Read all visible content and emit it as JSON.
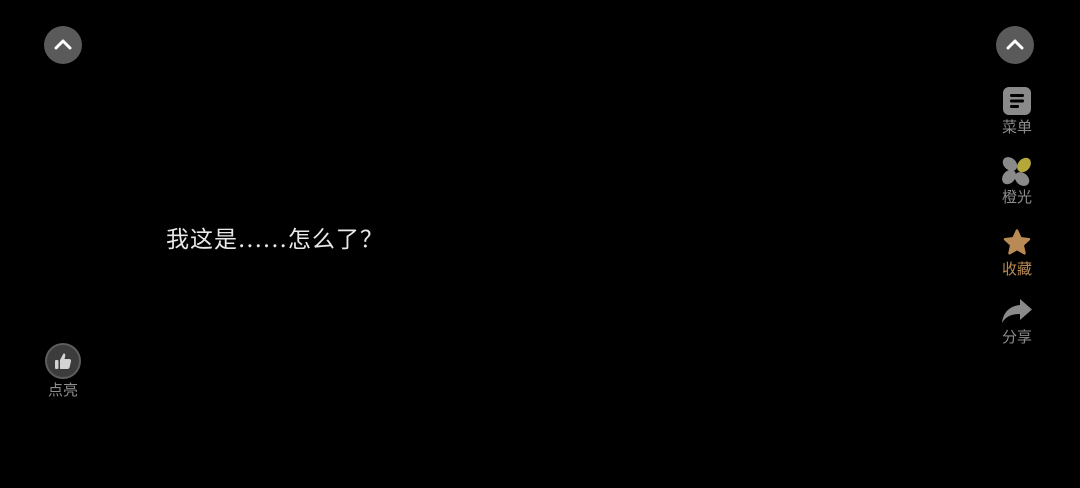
{
  "story": {
    "dialogue_text": "我这是......怎么了？"
  },
  "controls": {
    "collapse_left_icon": "chevron-up-icon",
    "collapse_right_icon": "chevron-up-icon"
  },
  "side_menu": {
    "items": [
      {
        "key": "menu",
        "label": "菜单",
        "icon": "list-icon"
      },
      {
        "key": "orange-light",
        "label": "橙光",
        "icon": "orange-light-logo-icon"
      },
      {
        "key": "favorite",
        "label": "收藏",
        "icon": "star-icon",
        "active": true
      },
      {
        "key": "share",
        "label": "分享",
        "icon": "share-arrow-icon"
      }
    ]
  },
  "like": {
    "label": "点亮",
    "icon": "thumbs-up-icon"
  },
  "colors": {
    "background": "#000000",
    "text": "#e9e9e9",
    "muted": "#8c8c8c",
    "button_gray": "#5a5a5a",
    "accent": "#b98a55",
    "logo_yellow": "#b4a83a"
  }
}
